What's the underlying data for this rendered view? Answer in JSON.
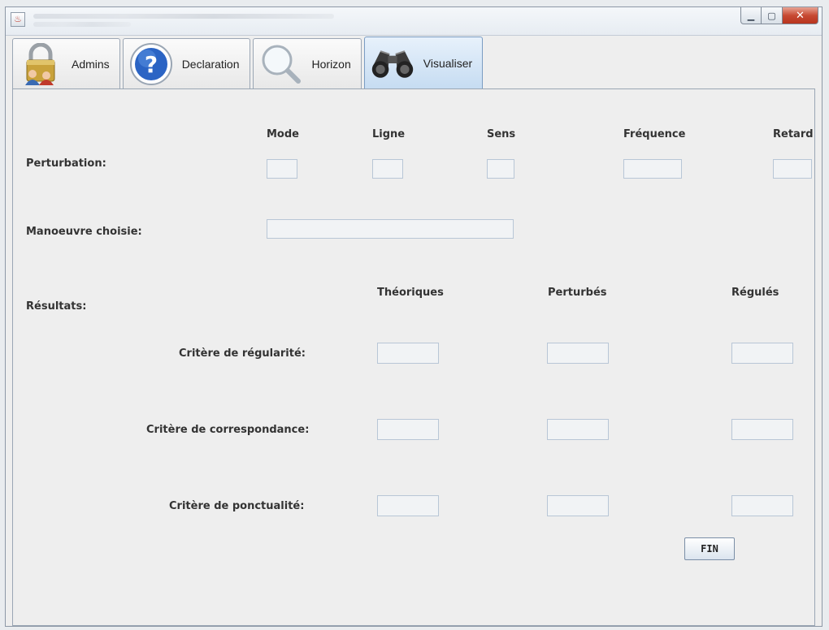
{
  "window": {
    "title": ""
  },
  "tabs": [
    {
      "label": "Admins",
      "icon": "padlock-users-icon",
      "active": false
    },
    {
      "label": "Declaration",
      "icon": "help-question-icon",
      "active": false
    },
    {
      "label": "Horizon",
      "icon": "magnifier-icon",
      "active": false
    },
    {
      "label": "Visualiser",
      "icon": "binoculars-icon",
      "active": true
    }
  ],
  "perturbation": {
    "row_label": "Perturbation:",
    "headers": {
      "mode": "Mode",
      "ligne": "Ligne",
      "sens": "Sens",
      "frequence": "Fréquence",
      "retard": "Retard"
    },
    "values": {
      "mode": "",
      "ligne": "",
      "sens": "",
      "frequence": "",
      "retard": ""
    }
  },
  "manoeuvre": {
    "label": "Manoeuvre choisie:",
    "value": ""
  },
  "resultats": {
    "label": "Résultats:",
    "columns": {
      "theoriques": "Théoriques",
      "perturbes": "Perturbés",
      "regules": "Régulés"
    },
    "rows": [
      {
        "label": "Critère de régularité:",
        "theoriques": "",
        "perturbes": "",
        "regules": ""
      },
      {
        "label": "Critère de correspondance:",
        "theoriques": "",
        "perturbes": "",
        "regules": ""
      },
      {
        "label": "Critère de ponctualité:",
        "theoriques": "",
        "perturbes": "",
        "regules": ""
      }
    ]
  },
  "buttons": {
    "fin": "FIN"
  },
  "colors": {
    "panel_bg": "#eeeeee",
    "field_border": "#b8c6d6",
    "active_tab": "#c6dcf2"
  }
}
